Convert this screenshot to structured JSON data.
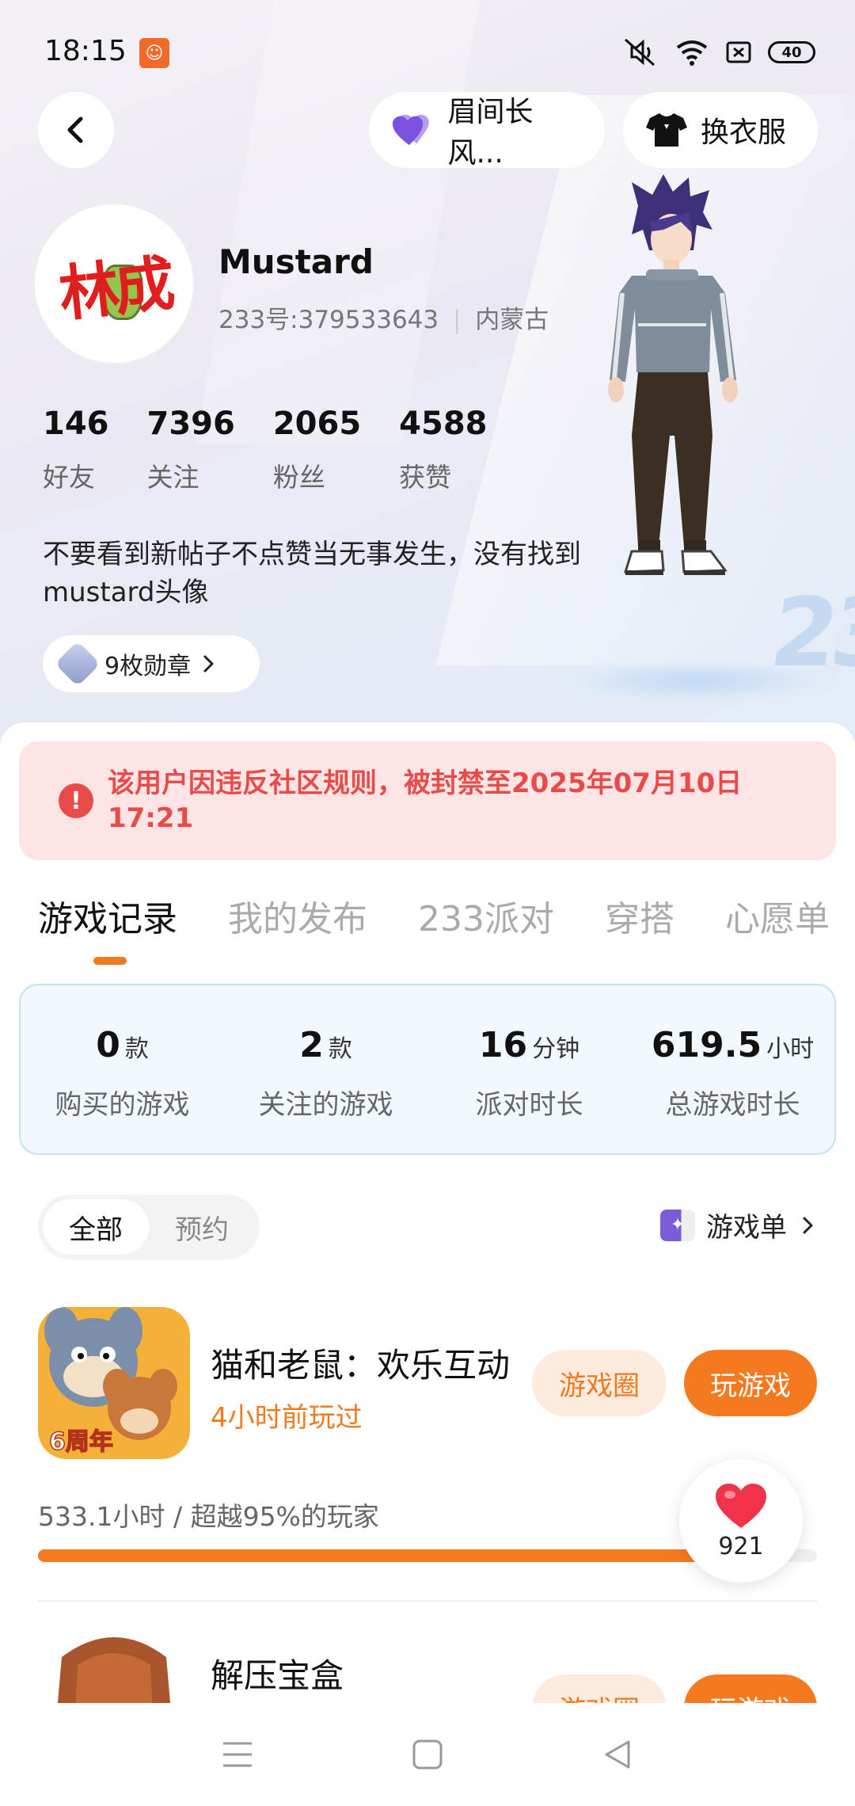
{
  "status_bar": {
    "time": "18:15",
    "battery": "40"
  },
  "header": {
    "mood_label": "眉间长风...",
    "outfit_label": "换衣服"
  },
  "profile": {
    "avatar_text": "林成",
    "username": "Mustard",
    "user_id": "233号:379533643",
    "location": "内蒙古",
    "stats": [
      {
        "value": "146",
        "label": "好友"
      },
      {
        "value": "7396",
        "label": "关注"
      },
      {
        "value": "2065",
        "label": "粉丝"
      },
      {
        "value": "4588",
        "label": "获赞"
      }
    ],
    "bio": "不要看到新帖子不点赞当无事发生，没有找到mustard头像",
    "badges_label": "9枚勋章"
  },
  "ban_notice": "该用户因违反社区规则，被封禁至2025年07月10日 17:21",
  "tabs": [
    "游戏记录",
    "我的发布",
    "233派对",
    "穿搭",
    "心愿单"
  ],
  "summary": [
    {
      "value": "0",
      "unit": "款",
      "label": "购买的游戏"
    },
    {
      "value": "2",
      "unit": "款",
      "label": "关注的游戏"
    },
    {
      "value": "16",
      "unit": "分钟",
      "label": "派对时长"
    },
    {
      "value": "619.5",
      "unit": "小时",
      "label": "总游戏时长"
    }
  ],
  "filters": [
    "全部",
    "预约"
  ],
  "game_list_label": "游戏单",
  "games": [
    {
      "name": "猫和老鼠：欢乐互动",
      "subtitle": "4小时前玩过",
      "icon_text": "6周年",
      "circle_label": "游戏圈",
      "play_label": "玩游戏",
      "playtime_text": "533.1小时 / 超越95%的玩家",
      "progress": 0.95
    },
    {
      "name": "解压宝盒",
      "circle_label": "游戏圈",
      "play_label": "玩游戏"
    }
  ],
  "like_count": "921",
  "colors": {
    "accent": "#f57a1f",
    "ban_red": "#e94b4b",
    "ban_bg": "#fde5e5"
  }
}
